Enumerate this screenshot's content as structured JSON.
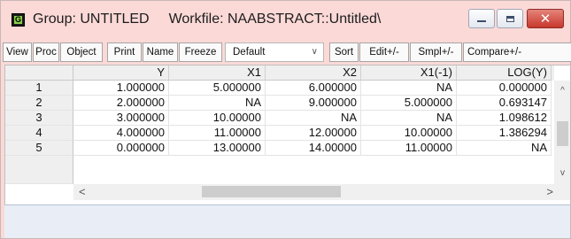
{
  "titlebar": {
    "icon_letter": "G",
    "group_title": "Group: UNTITLED",
    "workfile_title": "Workfile: NAABSTRACT::Untitled\\",
    "minimize_icon": "minimize-icon",
    "maximize_icon": "maximize-icon",
    "close_icon": "close-icon",
    "close_glyph": "✕"
  },
  "toolbar": {
    "buttons": [
      "View",
      "Proc",
      "Object",
      "Print",
      "Name",
      "Freeze"
    ],
    "display_select": "Default",
    "buttons2": [
      "Sort",
      "Edit+/-",
      "Smpl+/-",
      "Compare+/-"
    ]
  },
  "table": {
    "columns": [
      "Y",
      "X1",
      "X2",
      "X1(-1)",
      "LOG(Y)"
    ],
    "rows": [
      {
        "label": "1",
        "values": [
          "1.000000",
          "5.000000",
          "6.000000",
          "NA",
          "0.000000"
        ]
      },
      {
        "label": "2",
        "values": [
          "2.000000",
          "NA",
          "9.000000",
          "5.000000",
          "0.693147"
        ]
      },
      {
        "label": "3",
        "values": [
          "3.000000",
          "10.00000",
          "NA",
          "NA",
          "1.098612"
        ]
      },
      {
        "label": "4",
        "values": [
          "4.000000",
          "11.00000",
          "12.00000",
          "10.00000",
          "1.386294"
        ]
      },
      {
        "label": "5",
        "values": [
          "0.000000",
          "13.00000",
          "14.00000",
          "11.00000",
          "NA"
        ]
      }
    ]
  },
  "scroll": {
    "up": "^",
    "down": "v",
    "left": "<",
    "right": ">"
  },
  "colors": {
    "window_bg": "#fbd9d7",
    "close_button": "#c8372c",
    "status_bg": "#e9eef6"
  }
}
